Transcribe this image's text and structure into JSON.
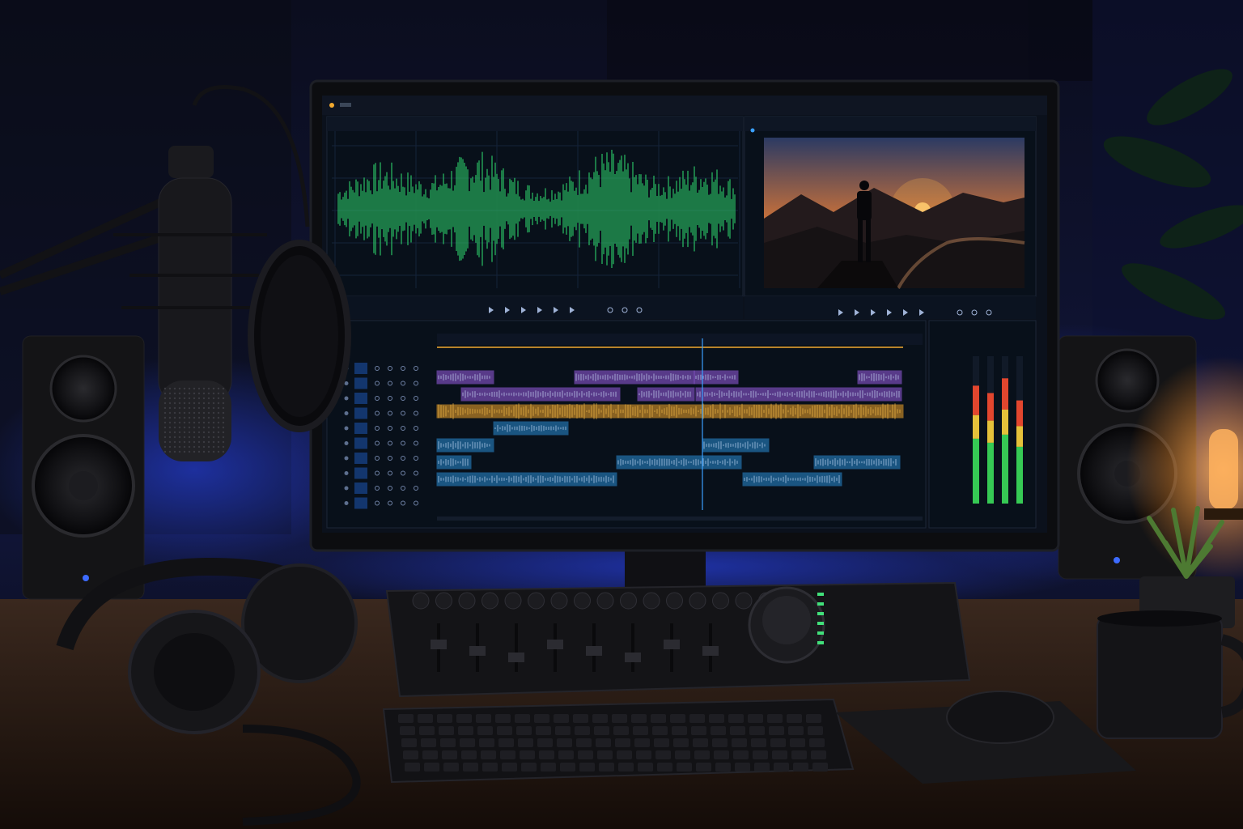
{
  "scene": {
    "description_tags": [
      "microphone",
      "pop-filter",
      "monitor",
      "studio-speaker",
      "headphones",
      "mixing-console",
      "keyboard",
      "mouse",
      "mouse-pad",
      "mug",
      "plant",
      "lamp"
    ]
  },
  "screen": {
    "waveform_panel": {
      "waveform_color": "#2fd36b"
    },
    "video_panel": {
      "sky_top": "#2b3a63",
      "sun_color": "#ffb347"
    },
    "timeline": {
      "track_colors": [
        "#9b5de5",
        "#9b5de5",
        "#f4a62a",
        "#2a8fd6",
        "#2a8fd6",
        "#2a8fd6",
        "#2a8fd6"
      ],
      "playhead_color": "#3aa0ff"
    },
    "meters": {
      "levels": [
        0.8,
        0.75,
        0.85,
        0.7
      ]
    }
  },
  "colors": {
    "ambient_blue": "#1f3cff",
    "lamp_glow": "#ff9a2e",
    "desk": "#2a1c15"
  }
}
